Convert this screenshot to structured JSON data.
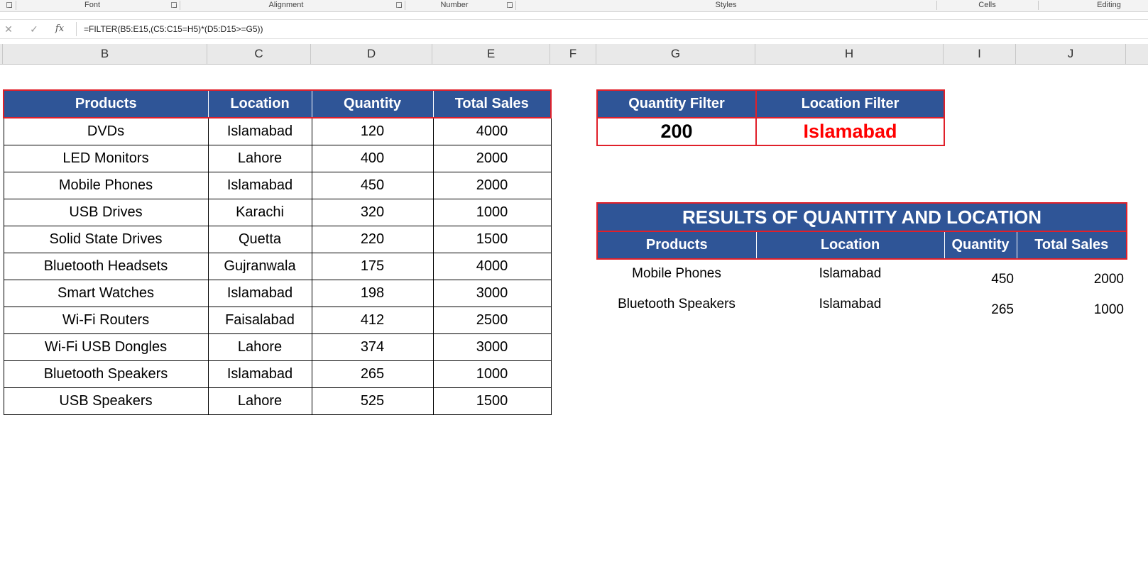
{
  "ribbon": {
    "groups": [
      "Font",
      "Alignment",
      "Number",
      "Styles",
      "Cells",
      "Editing"
    ]
  },
  "formula_bar": {
    "cancel_icon": "close-icon",
    "enter_icon": "check-icon",
    "fx_label": "fx",
    "formula": "=FILTER(B5:E15,(C5:C15=H5)*(D5:D15>=G5))"
  },
  "columns": [
    "B",
    "C",
    "D",
    "E",
    "F",
    "G",
    "H",
    "I",
    "J"
  ],
  "main_table": {
    "headers": [
      "Products",
      "Location",
      "Quantity",
      "Total Sales"
    ],
    "rows": [
      [
        "DVDs",
        "Islamabad",
        "120",
        "4000"
      ],
      [
        "LED Monitors",
        "Lahore",
        "400",
        "2000"
      ],
      [
        "Mobile Phones",
        "Islamabad",
        "450",
        "2000"
      ],
      [
        "USB Drives",
        "Karachi",
        "320",
        "1000"
      ],
      [
        "Solid State Drives",
        "Quetta",
        "220",
        "1500"
      ],
      [
        "Bluetooth Headsets",
        "Gujranwala",
        "175",
        "4000"
      ],
      [
        "Smart Watches",
        "Islamabad",
        "198",
        "3000"
      ],
      [
        "Wi-Fi Routers",
        "Faisalabad",
        "412",
        "2500"
      ],
      [
        "Wi-Fi USB Dongles",
        "Lahore",
        "374",
        "3000"
      ],
      [
        "Bluetooth Speakers",
        "Islamabad",
        "265",
        "1000"
      ],
      [
        "USB Speakers",
        "Lahore",
        "525",
        "1500"
      ]
    ]
  },
  "filters": {
    "quantity_label": "Quantity Filter",
    "location_label": "Location Filter",
    "quantity_value": "200",
    "location_value": "Islamabad"
  },
  "results": {
    "title": "RESULTS OF QUANTITY AND LOCATION",
    "headers": [
      "Products",
      "Location",
      "Quantity",
      "Total Sales"
    ],
    "rows": [
      [
        "Mobile Phones",
        "Islamabad",
        "450",
        "2000"
      ],
      [
        "Bluetooth Speakers",
        "Islamabad",
        "265",
        "1000"
      ]
    ]
  }
}
